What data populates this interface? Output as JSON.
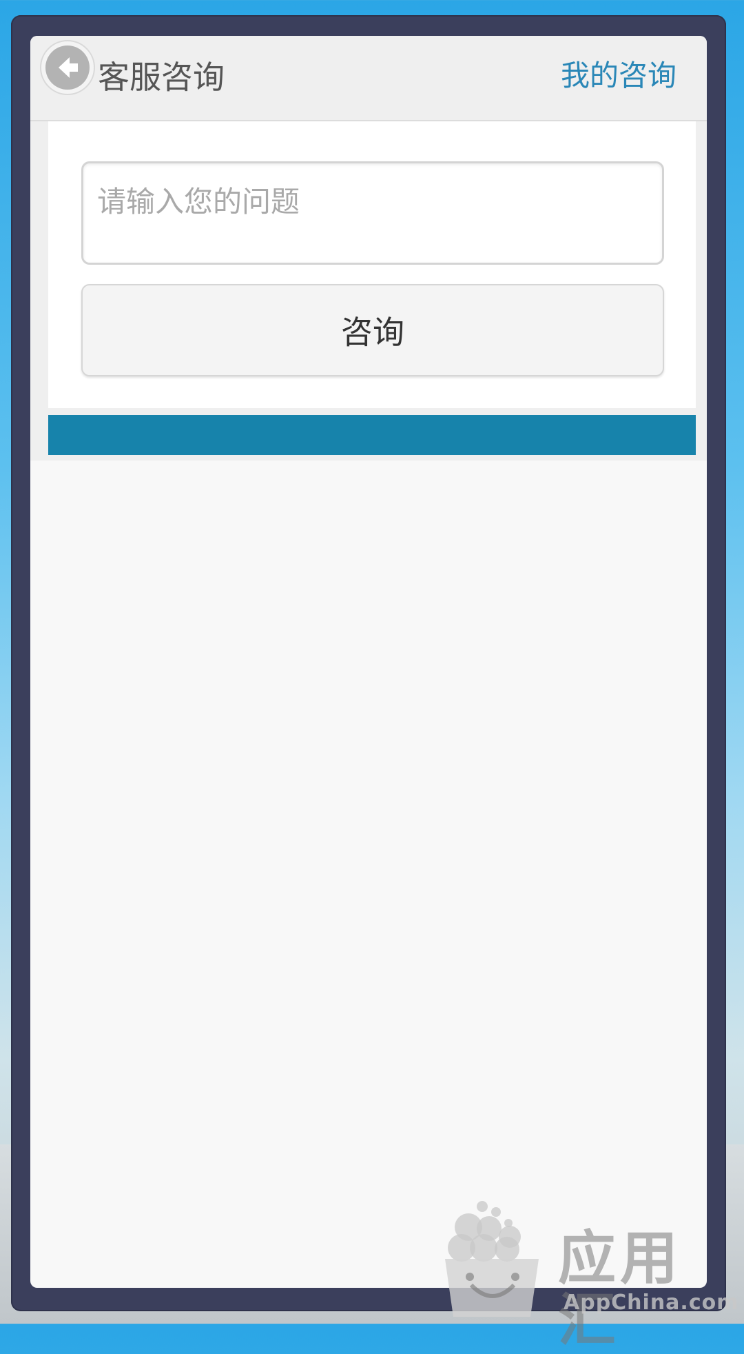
{
  "header": {
    "title": "客服咨询",
    "right_link": "我的咨询",
    "back_icon": "back-arrow-icon"
  },
  "form": {
    "question_placeholder": "请输入您的问题",
    "question_value": "",
    "submit_label": "咨询"
  },
  "watermark": {
    "text": "应用汇",
    "subtext": "AppChina.com"
  },
  "colors": {
    "accent_link": "#2a87b7",
    "blue_bar": "#1783ab",
    "frame": "#3b3f5c"
  }
}
